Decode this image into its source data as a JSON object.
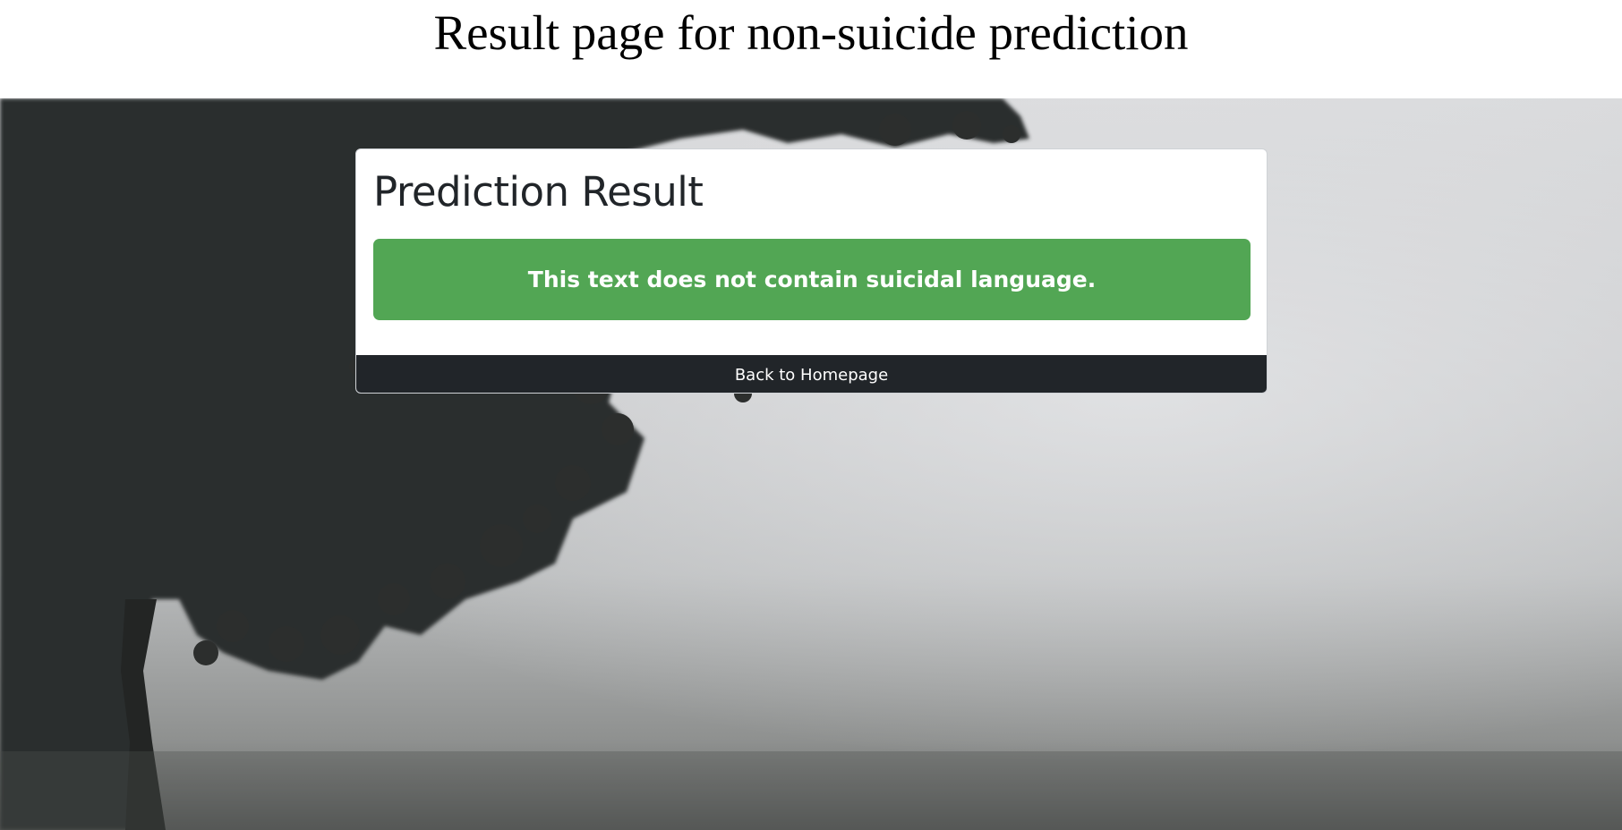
{
  "caption": {
    "text": "Result page for non-suicide prediction"
  },
  "result_card": {
    "title": "Prediction Result",
    "alert_message": "This text does not contain suicidal language.",
    "back_button_label": "Back to Homepage"
  },
  "colors": {
    "alert_success": "#52a654",
    "button_dark": "#212529",
    "title_text": "#212529",
    "card_background": "#ffffff"
  }
}
